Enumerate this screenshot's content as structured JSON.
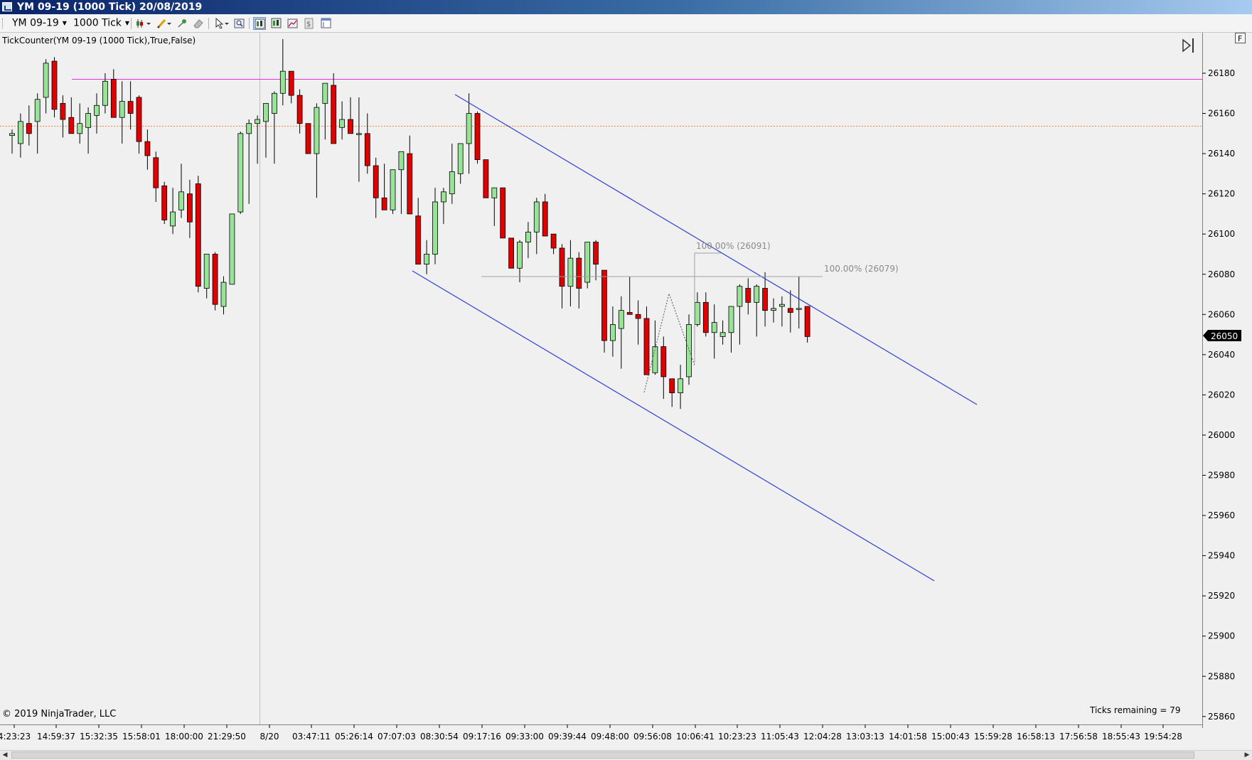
{
  "window": {
    "title": "YM 09-19 (1000 Tick)  20/08/2019"
  },
  "toolbar": {
    "instrument": "YM 09-19",
    "interval": "1000 Tick"
  },
  "chart": {
    "indicator_label": "TickCounter(YM 09-19 (1000 Tick),True,False)",
    "copyright": "© 2019 NinjaTrader, LLC",
    "ticks_remaining": "Ticks remaining = 79",
    "panel_button": "F",
    "current_price": "26050",
    "fib_label_1": "100.00% (26091)",
    "fib_label_2": "100.00% (26079)"
  },
  "colors": {
    "up": "#98e398",
    "down": "#e00000",
    "channel": "#2f3fd6",
    "magenta_line": "#e030e0",
    "orange_line": "#ff7f30",
    "background": "#f0f0f0"
  },
  "chart_data": {
    "type": "candlestick",
    "price_axis": {
      "ticks": [
        25860,
        25880,
        25900,
        25920,
        25940,
        25960,
        25980,
        26000,
        26020,
        26040,
        26060,
        26080,
        26100,
        26120,
        26140,
        26160,
        26180
      ],
      "range": [
        25856,
        26200
      ]
    },
    "time_axis": {
      "labels": [
        "4:23:23",
        "14:59:37",
        "15:32:35",
        "15:58:01",
        "18:00:00",
        "21:29:50",
        "8/20",
        "03:47:11",
        "05:26:14",
        "07:07:03",
        "08:30:54",
        "09:17:16",
        "09:33:00",
        "09:39:44",
        "09:48:00",
        "09:56:08",
        "10:06:41",
        "10:23:23",
        "11:05:43",
        "12:04:28",
        "13:03:13",
        "14:01:58",
        "15:00:43",
        "15:59:28",
        "16:58:13",
        "17:56:58",
        "18:55:43",
        "19:54:28"
      ]
    },
    "horizontal_lines": [
      {
        "price": 26177,
        "color": "magenta"
      },
      {
        "price": 26154,
        "color": "orange",
        "style": "dotted"
      }
    ],
    "candles": [
      [
        26149,
        26152,
        26140,
        26150
      ],
      [
        26145,
        26160,
        26138,
        26156
      ],
      [
        26155,
        26164,
        26144,
        26150
      ],
      [
        26156,
        26170,
        26140,
        26167
      ],
      [
        26168,
        26187,
        26160,
        26185
      ],
      [
        26186,
        26188,
        26158,
        26162
      ],
      [
        26165,
        26169,
        26148,
        26157
      ],
      [
        26158,
        26168,
        26150,
        26150
      ],
      [
        26150,
        26165,
        26145,
        26155
      ],
      [
        26153,
        26163,
        26140,
        26160
      ],
      [
        26159,
        26170,
        26150,
        26164
      ],
      [
        26164,
        26180,
        26160,
        26176
      ],
      [
        26177,
        26182,
        26165,
        26158
      ],
      [
        26158,
        26176,
        26145,
        26166
      ],
      [
        26166,
        26176,
        26152,
        26160
      ],
      [
        26168,
        26169,
        26140,
        26146
      ],
      [
        26146,
        26152,
        26132,
        26139
      ],
      [
        26138,
        26141,
        26116,
        26123
      ],
      [
        26124,
        26126,
        26105,
        26107
      ],
      [
        26104,
        26123,
        26100,
        26111
      ],
      [
        26112,
        26135,
        26108,
        26121
      ],
      [
        26120,
        26127,
        26098,
        26106
      ],
      [
        26125,
        26129,
        26071,
        26074
      ],
      [
        26073,
        26090,
        26068,
        26090
      ],
      [
        26090,
        26091,
        26062,
        26065
      ],
      [
        26064,
        26079,
        26060,
        26076
      ],
      [
        26075,
        26110,
        26075,
        26110
      ],
      [
        26111,
        26151,
        26110,
        26150
      ],
      [
        26150,
        26157,
        26115,
        26155
      ],
      [
        26155,
        26159,
        26135,
        26157
      ],
      [
        26156,
        26162,
        26138,
        26165
      ],
      [
        26160,
        26171,
        26135,
        26170
      ],
      [
        26170,
        26197,
        26164,
        26181
      ],
      [
        26181,
        26180,
        26165,
        26169
      ],
      [
        26169,
        26172,
        26150,
        26155
      ],
      [
        26155,
        26149,
        26145,
        26140
      ],
      [
        26140,
        26165,
        26118,
        26163
      ],
      [
        26165,
        26175,
        26147,
        26175
      ],
      [
        26174,
        26180,
        26145,
        26145
      ],
      [
        26153,
        26166,
        26147,
        26157
      ],
      [
        26157,
        26168,
        26150,
        26150
      ],
      [
        26150,
        26168,
        26126,
        26150
      ],
      [
        26150,
        26160,
        26130,
        26134
      ],
      [
        26134,
        26138,
        26108,
        26118
      ],
      [
        26118,
        26135,
        26112,
        26112
      ],
      [
        26112,
        26132,
        26110,
        26132
      ],
      [
        26132,
        26139,
        26110,
        26141
      ],
      [
        26140,
        26149,
        26110,
        26110
      ],
      [
        26109,
        26118,
        26100,
        26085
      ],
      [
        26085,
        26097,
        26080,
        26090
      ],
      [
        26090,
        26123,
        26085,
        26116
      ],
      [
        26116,
        26123,
        26105,
        26121
      ],
      [
        26120,
        26145,
        26115,
        26131
      ],
      [
        26130,
        26144,
        26125,
        26145
      ],
      [
        26145,
        26170,
        26130,
        26160
      ],
      [
        26160,
        26161,
        26135,
        26137
      ],
      [
        26137,
        26130,
        26120,
        26118
      ],
      [
        26118,
        26123,
        26104,
        26123
      ],
      [
        26123,
        26116,
        26099,
        26098
      ],
      [
        26098,
        26083,
        26088,
        26083
      ],
      [
        26083,
        26097,
        26076,
        26096
      ],
      [
        26096,
        26106,
        26088,
        26101
      ],
      [
        26101,
        26118,
        26090,
        26116
      ],
      [
        26116,
        26120,
        26099,
        26099
      ],
      [
        26100,
        26098,
        26090,
        26093
      ],
      [
        26093,
        26095,
        26063,
        26074
      ],
      [
        26074,
        26097,
        26064,
        26088
      ],
      [
        26088,
        26091,
        26063,
        26073
      ],
      [
        26076,
        26096,
        26073,
        26096
      ],
      [
        26096,
        26097,
        26077,
        26085
      ],
      [
        26082,
        26070,
        26041,
        26047
      ],
      [
        26047,
        26064,
        26039,
        26055
      ],
      [
        26053,
        26069,
        26033,
        26062
      ],
      [
        26061,
        26079,
        26064,
        26060
      ],
      [
        26060,
        26067,
        26045,
        26058
      ],
      [
        26058,
        26064,
        26030,
        26030
      ],
      [
        26031,
        26057,
        26030,
        26044
      ],
      [
        26044,
        26049,
        26018,
        26029
      ],
      [
        26028,
        26026,
        26014,
        26021
      ],
      [
        26021,
        26035,
        26013,
        26028
      ],
      [
        26029,
        26060,
        26025,
        26055
      ],
      [
        26055,
        26071,
        26054,
        26066
      ],
      [
        26066,
        26071,
        26049,
        26051
      ],
      [
        26051,
        26065,
        26038,
        26056
      ],
      [
        26049,
        26057,
        26045,
        26051
      ],
      [
        26051,
        26064,
        26041,
        26064
      ],
      [
        26064,
        26075,
        26045,
        26074
      ],
      [
        26073,
        26078,
        26060,
        26066
      ],
      [
        26066,
        26075,
        26049,
        26074
      ],
      [
        26073,
        26081,
        26054,
        26062
      ],
      [
        26062,
        26068,
        26056,
        26063
      ],
      [
        26064,
        26069,
        26054,
        26065
      ],
      [
        26063,
        26072,
        26051,
        26061
      ],
      [
        26063,
        26079,
        26053,
        26063
      ],
      [
        26064,
        26062,
        26046,
        26049
      ]
    ],
    "channel": {
      "upper": {
        "from": [
          "08:30:54",
          26170
        ],
        "to": [
          "14:01:58",
          26015
        ]
      },
      "lower": {
        "from": [
          "07:07:03",
          26083
        ],
        "to": [
          "13:03:13",
          25928
        ]
      }
    },
    "fib_levels": [
      {
        "label": "100.00% (26091)",
        "price": 26091
      },
      {
        "label": "100.00% (26079)",
        "price": 26079
      }
    ]
  }
}
